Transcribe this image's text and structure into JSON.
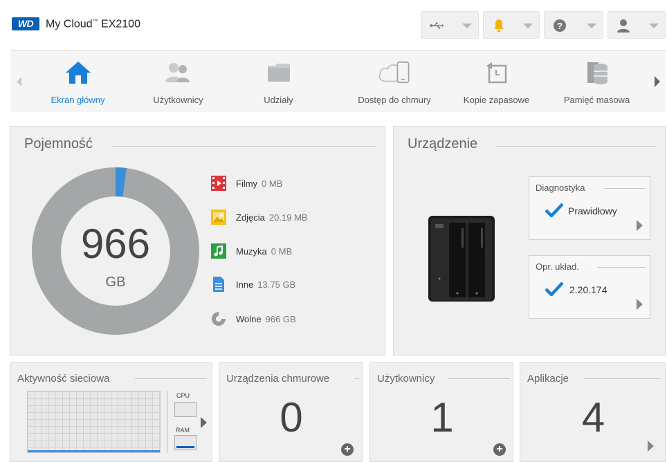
{
  "header": {
    "logo_text": "WD",
    "product_name": "My Cloud",
    "product_tm": "™",
    "product_model": "EX2100",
    "buttons": [
      {
        "icon": "usb-icon"
      },
      {
        "icon": "bell-icon",
        "color": "#f5b400"
      },
      {
        "icon": "help-icon"
      },
      {
        "icon": "user-icon"
      }
    ]
  },
  "nav": {
    "items": [
      {
        "label": "Ekran główny",
        "icon": "home-icon",
        "active": true
      },
      {
        "label": "Użytkownicy",
        "icon": "users-icon"
      },
      {
        "label": "Udziały",
        "icon": "folder-icon"
      },
      {
        "label": "Dostęp do chmury",
        "icon": "cloud-device-icon"
      },
      {
        "label": "Kopie zapasowe",
        "icon": "backup-icon"
      },
      {
        "label": "Pamięć masowa",
        "icon": "storage-icon"
      }
    ]
  },
  "capacity": {
    "title": "Pojemność",
    "value": "966",
    "unit": "GB",
    "used_fraction": 0.021,
    "legend": [
      {
        "name": "Filmy",
        "value": "0 MB",
        "icon": "film-icon",
        "color": "#d9363e"
      },
      {
        "name": "Zdjęcia",
        "value": "20.19 MB",
        "icon": "photo-icon",
        "color": "#f0c419"
      },
      {
        "name": "Muzyka",
        "value": "0 MB",
        "icon": "music-icon",
        "color": "#2f9e44"
      },
      {
        "name": "Inne",
        "value": "13.75 GB",
        "icon": "document-icon",
        "color": "#3b8fd9"
      },
      {
        "name": "Wolne",
        "value": "966 GB",
        "icon": "pie-icon",
        "color": "#999999"
      }
    ]
  },
  "device": {
    "title": "Urządzenie",
    "diagnostics": {
      "title": "Diagnostyka",
      "status": "Prawidłowy"
    },
    "firmware": {
      "title": "Opr. układ.",
      "version": "2.20.174"
    }
  },
  "network": {
    "title": "Aktywność sieciowa",
    "cpu_label": "CPU",
    "ram_label": "RAM"
  },
  "cloud_devices": {
    "title": "Urządzenia chmurowe",
    "count": "0"
  },
  "users": {
    "title": "Użytkownicy",
    "count": "1"
  },
  "apps": {
    "title": "Aplikacje",
    "count": "4"
  },
  "colors": {
    "accent": "#1a7fd6",
    "donut_free": "#a3a7a8",
    "donut_used": "#3b8fd9"
  }
}
